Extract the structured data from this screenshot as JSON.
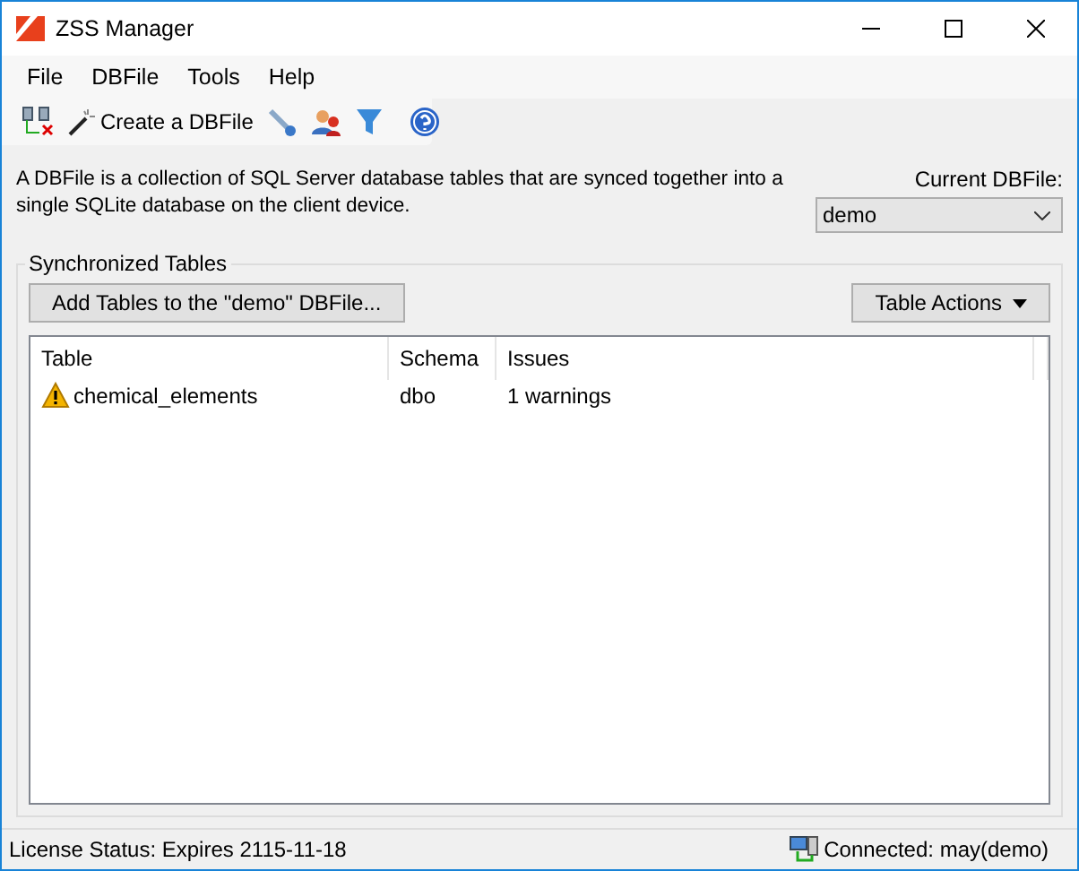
{
  "window": {
    "title": "ZSS Manager"
  },
  "menu": [
    "File",
    "DBFile",
    "Tools",
    "Help"
  ],
  "toolbar": {
    "create_label": "Create a DBFile"
  },
  "description": "A DBFile is a collection of SQL Server database tables that are synced together into a single SQLite database on the client device.",
  "current_dbfile": {
    "label": "Current DBFile:",
    "value": "demo"
  },
  "group": {
    "title": "Synchronized Tables",
    "add_button": "Add Tables to the \"demo\" DBFile...",
    "actions_button": "Table Actions"
  },
  "table": {
    "columns": [
      "Table",
      "Schema",
      "Issues"
    ],
    "rows": [
      {
        "kind": "warning",
        "table": "chemical_elements",
        "schema": "dbo",
        "issues": "1 warnings"
      }
    ]
  },
  "status_bar": {
    "license": "License Status: Expires 2115-11-18",
    "connection": "Connected: may(demo)"
  }
}
